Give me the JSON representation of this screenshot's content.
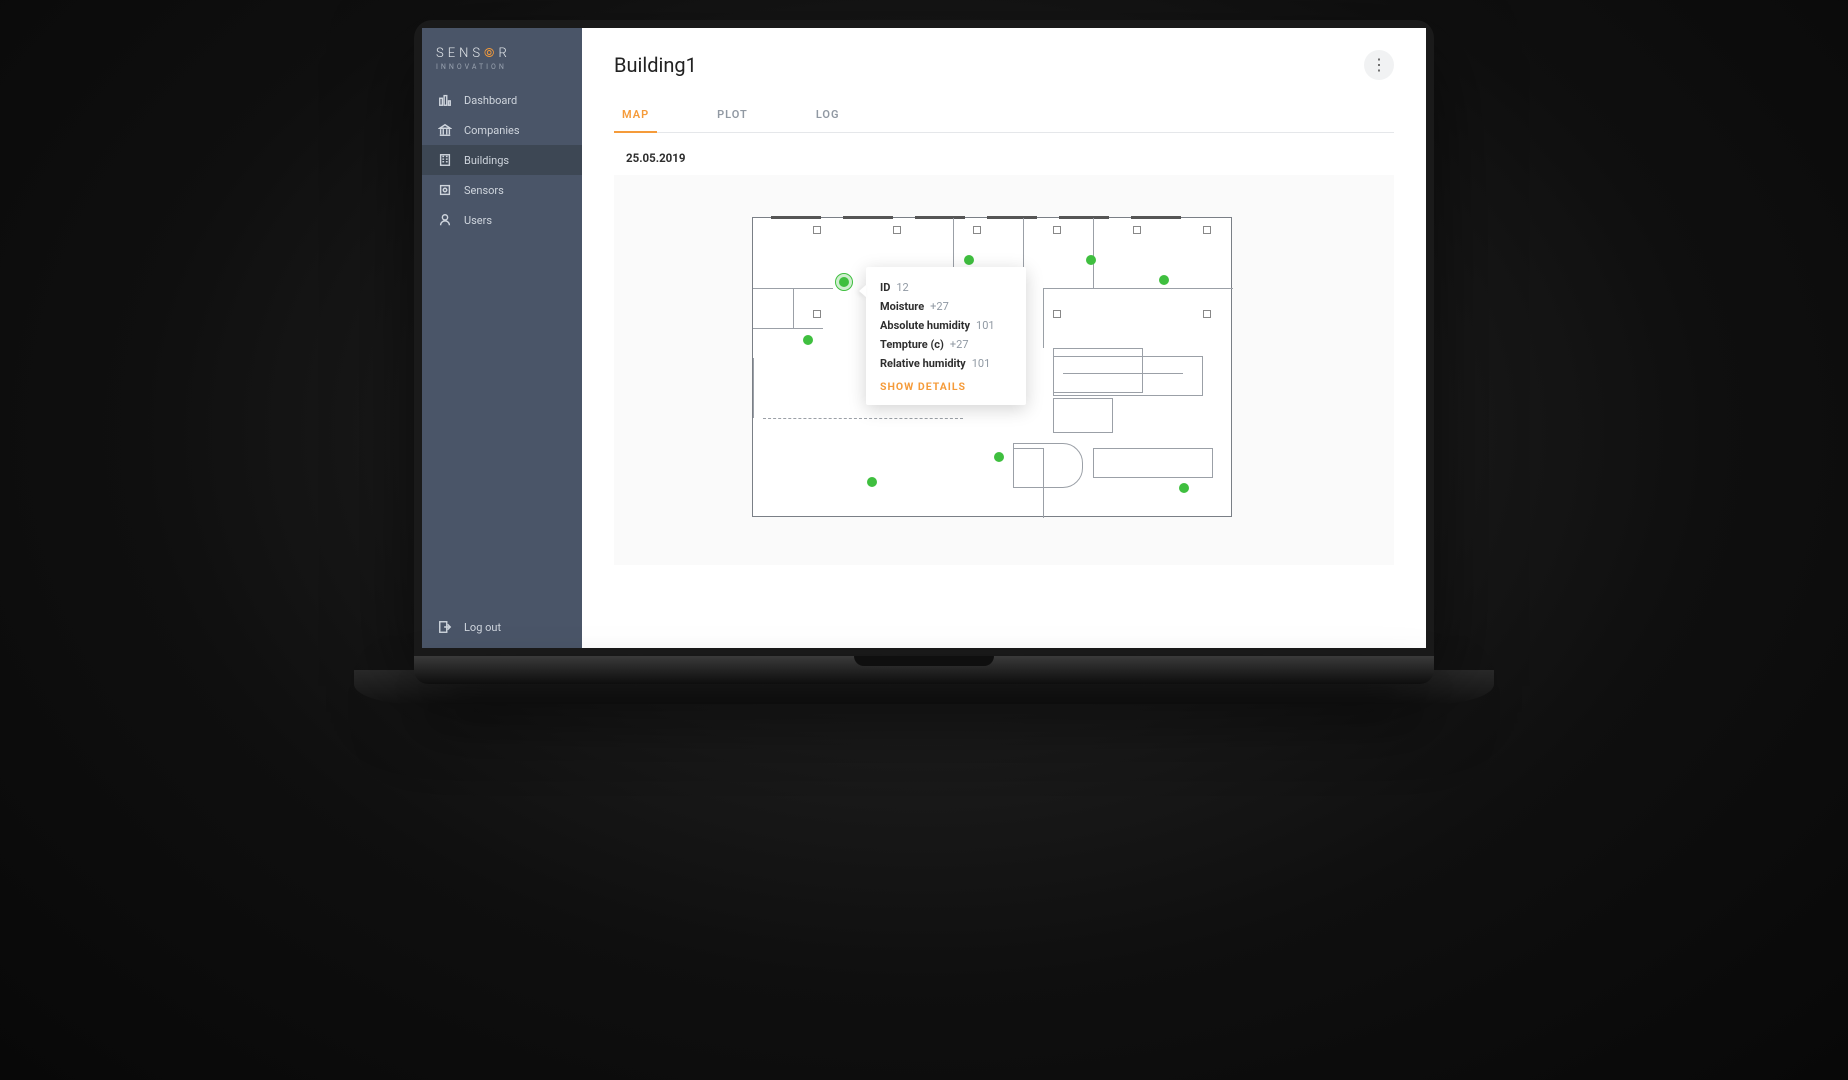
{
  "logo": {
    "text_a": "SENS",
    "text_b": "R",
    "sub": "INNOVATION"
  },
  "sidebar": {
    "items": [
      {
        "label": "Dashboard"
      },
      {
        "label": "Companies"
      },
      {
        "label": "Buildings"
      },
      {
        "label": "Sensors"
      },
      {
        "label": "Users"
      }
    ],
    "logout_label": "Log out"
  },
  "header": {
    "title": "Building1"
  },
  "tabs": [
    {
      "label": "MAP"
    },
    {
      "label": "PLOT"
    },
    {
      "label": "LOG"
    }
  ],
  "date": "25.05.2019",
  "tooltip": {
    "rows": [
      {
        "label": "ID",
        "value": "12"
      },
      {
        "label": "Moisture",
        "value": "+27"
      },
      {
        "label": "Absolute humidity",
        "value": "101"
      },
      {
        "label": "Tempture (c)",
        "value": "+27"
      },
      {
        "label": "Relative humidity",
        "value": "101"
      }
    ],
    "action_label": "SHOW DETAILS"
  },
  "colors": {
    "accent": "#f59b3a",
    "sensor": "#3fbf3f",
    "sidebar_bg": "#4a5568"
  }
}
